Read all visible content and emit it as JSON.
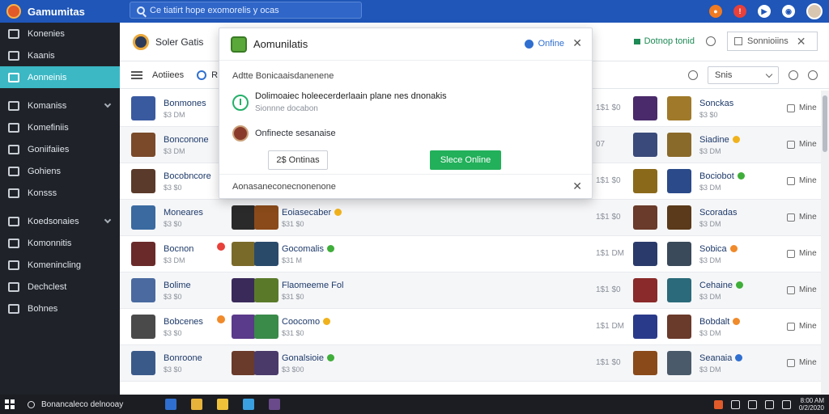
{
  "topbar": {
    "brand": "Gamumitas",
    "search_placeholder": "Ce tiatirt hope exomorelis y ocas",
    "icons": [
      "fire-icon",
      "notification-icon",
      "play-icon",
      "camera-icon",
      "user-avatar"
    ]
  },
  "sidebar": {
    "items": [
      {
        "label": "Konenies",
        "icon": "home-icon"
      },
      {
        "label": "Kaanis",
        "icon": "tag-icon"
      },
      {
        "label": "Aonneinis",
        "icon": "list-icon",
        "active": true
      },
      {
        "label": "Komaniss",
        "icon": "grid-icon",
        "chevron": true
      },
      {
        "label": "Komefiniis",
        "icon": "list-icon"
      },
      {
        "label": "Goniifaiies",
        "icon": "globe-icon"
      },
      {
        "label": "Gohiens",
        "icon": "chart-icon"
      },
      {
        "label": "Konsss",
        "icon": "tag-icon"
      },
      {
        "label": "Koedsonaies",
        "icon": "grid-icon",
        "chevron": true
      },
      {
        "label": "Komonnitis",
        "icon": "wrench-icon"
      },
      {
        "label": "Komenincling",
        "icon": "tools-icon"
      },
      {
        "label": "Dechclest",
        "icon": "fire-icon"
      },
      {
        "label": "Bohnes",
        "icon": "lock-icon"
      }
    ]
  },
  "header": {
    "app_title": "Soler Gatis",
    "link_label": "Dotnop tonid",
    "box_label": "Sonnioiins"
  },
  "toolbar": {
    "label": "Aotiiees",
    "search_hint": "R",
    "select_value": "Snis"
  },
  "rows": [
    {
      "name": "Bonmones",
      "sub": "$3 DM",
      "name2": "",
      "sub2": "",
      "size": "1$1 $0",
      "name3": "Sonckas",
      "sub3": "$3 $0",
      "badge2": "",
      "badge3": "",
      "flag": ""
    },
    {
      "name": "Bonconone",
      "sub": "$3 DM",
      "name2": "",
      "sub2": "",
      "size": "07",
      "name3": "Siadine",
      "sub3": "$3 DM",
      "badge2": "",
      "badge3": "gold",
      "flag": ""
    },
    {
      "name": "Bocobncore",
      "sub": "$3 $0",
      "name2": "",
      "sub2": "",
      "size": "1$1 $0",
      "name3": "Bociobot",
      "sub3": "$3 DM",
      "badge2": "",
      "badge3": "green",
      "flag": ""
    },
    {
      "name": "Moneares",
      "sub": "$3 $0",
      "name2": "Eoiasecaber",
      "sub2": "$31 $0",
      "size": "1$1 $0",
      "name3": "Scoradas",
      "sub3": "$3 DM",
      "badge2": "gold",
      "badge3": "",
      "flag": ""
    },
    {
      "name": "Bocnon",
      "sub": "$3 DM",
      "name2": "Gocomalis",
      "sub2": "$31 M",
      "size": "1$1 DM",
      "name3": "Sobica",
      "sub3": "$3 DM",
      "badge2": "green",
      "badge3": "orange",
      "flag": "red"
    },
    {
      "name": "Bolime",
      "sub": "$3 $0",
      "name2": "Flaomeeme Fol",
      "sub2": "$31 $0",
      "size": "1$1 $0",
      "name3": "Cehaine",
      "sub3": "$3 DM",
      "badge2": "",
      "badge3": "green",
      "flag": ""
    },
    {
      "name": "Bobcenes",
      "sub": "$3 $0",
      "name2": "Coocomo",
      "sub2": "$31 $0",
      "size": "1$1 DM",
      "name3": "Bobdalt",
      "sub3": "$3 DM",
      "badge2": "gold",
      "badge3": "orange",
      "flag": "orange"
    },
    {
      "name": "Bonroone",
      "sub": "$3 $0",
      "name2": "Gonalsioie",
      "sub2": "$3 $00",
      "size": "1$1 $0",
      "name3": "Seanaia",
      "sub3": "$3 DM",
      "badge2": "green",
      "badge3": "blue",
      "flag": ""
    }
  ],
  "more_label": "Mine",
  "modal": {
    "title": "Aomunilatis",
    "status": "Onfine",
    "subtitle": "Adtte Bonicaaisdanenene",
    "info_line1": "Dolimoaiec holeecerderlaain plane nes dnonakis",
    "info_line2": "Sionnne docabon",
    "user_line": "Onfinecte sesanaise",
    "btn_left": "2$ Ontinas",
    "btn_right": "Slece Online",
    "footer": "Aonasaneconecnonenone"
  },
  "taskbar": {
    "search": "Bonancaleco delnooay",
    "clock_time": "8:00 AM",
    "clock_date": "0/2/2020"
  },
  "colors": {
    "topbar": "#1f56b8",
    "sidebar": "#1f2329",
    "sidebar_active": "#3bb8c4",
    "primary_button": "#22b05a",
    "accent_blue": "#2f6fd0"
  }
}
